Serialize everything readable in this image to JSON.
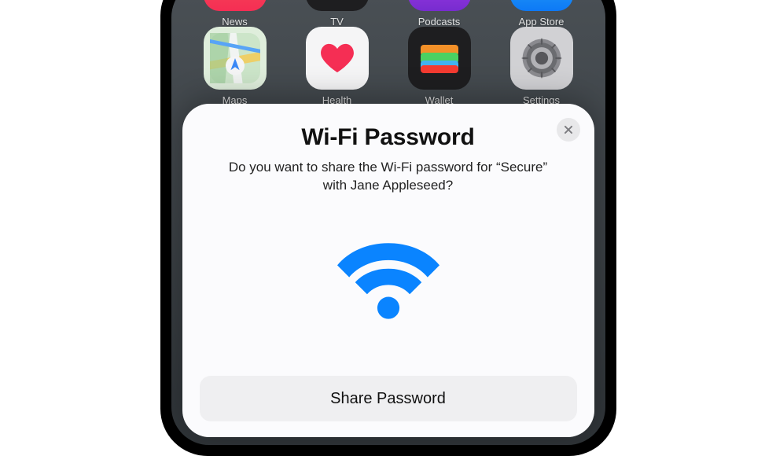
{
  "home": {
    "row1": [
      {
        "name": "news",
        "label": "News"
      },
      {
        "name": "tv",
        "label": "TV"
      },
      {
        "name": "podcasts",
        "label": "Podcasts"
      },
      {
        "name": "appstore",
        "label": "App Store"
      }
    ],
    "row2": [
      {
        "name": "maps",
        "label": "Maps"
      },
      {
        "name": "health",
        "label": "Health"
      },
      {
        "name": "wallet",
        "label": "Wallet"
      },
      {
        "name": "settings",
        "label": "Settings"
      }
    ]
  },
  "modal": {
    "title": "Wi-Fi Password",
    "description": "Do you want to share the Wi-Fi password for “Secure” with Jane Appleseed?",
    "share_label": "Share Password"
  },
  "colors": {
    "wifi_blue": "#0a84ff",
    "close_bg": "#e8e8ea",
    "close_x": "#7a7a7e",
    "button_bg": "#efeff1"
  }
}
